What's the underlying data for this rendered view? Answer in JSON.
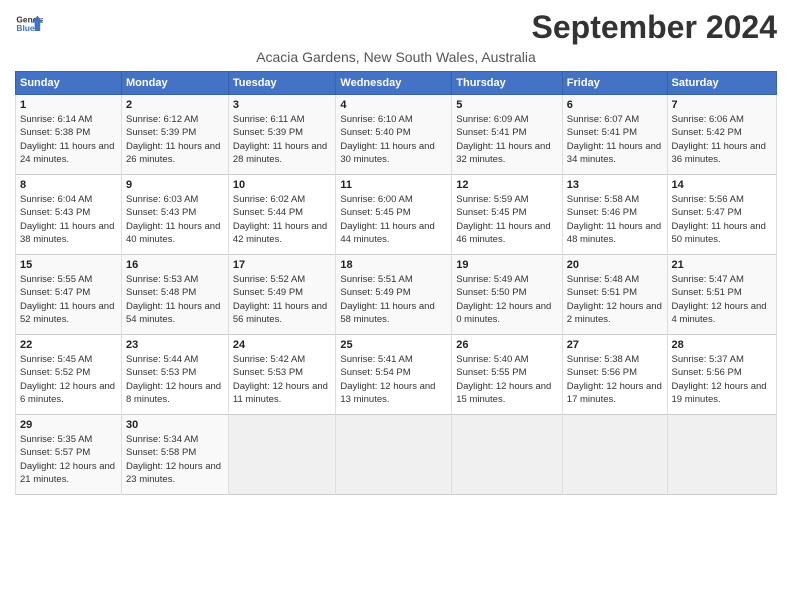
{
  "header": {
    "logo_line1": "General",
    "logo_line2": "Blue",
    "month": "September 2024",
    "location": "Acacia Gardens, New South Wales, Australia"
  },
  "weekdays": [
    "Sunday",
    "Monday",
    "Tuesday",
    "Wednesday",
    "Thursday",
    "Friday",
    "Saturday"
  ],
  "weeks": [
    [
      {
        "day": "1",
        "sunrise": "6:14 AM",
        "sunset": "5:38 PM",
        "daylight": "11 hours and 24 minutes."
      },
      {
        "day": "2",
        "sunrise": "6:12 AM",
        "sunset": "5:39 PM",
        "daylight": "11 hours and 26 minutes."
      },
      {
        "day": "3",
        "sunrise": "6:11 AM",
        "sunset": "5:39 PM",
        "daylight": "11 hours and 28 minutes."
      },
      {
        "day": "4",
        "sunrise": "6:10 AM",
        "sunset": "5:40 PM",
        "daylight": "11 hours and 30 minutes."
      },
      {
        "day": "5",
        "sunrise": "6:09 AM",
        "sunset": "5:41 PM",
        "daylight": "11 hours and 32 minutes."
      },
      {
        "day": "6",
        "sunrise": "6:07 AM",
        "sunset": "5:41 PM",
        "daylight": "11 hours and 34 minutes."
      },
      {
        "day": "7",
        "sunrise": "6:06 AM",
        "sunset": "5:42 PM",
        "daylight": "11 hours and 36 minutes."
      }
    ],
    [
      {
        "day": "8",
        "sunrise": "6:04 AM",
        "sunset": "5:43 PM",
        "daylight": "11 hours and 38 minutes."
      },
      {
        "day": "9",
        "sunrise": "6:03 AM",
        "sunset": "5:43 PM",
        "daylight": "11 hours and 40 minutes."
      },
      {
        "day": "10",
        "sunrise": "6:02 AM",
        "sunset": "5:44 PM",
        "daylight": "11 hours and 42 minutes."
      },
      {
        "day": "11",
        "sunrise": "6:00 AM",
        "sunset": "5:45 PM",
        "daylight": "11 hours and 44 minutes."
      },
      {
        "day": "12",
        "sunrise": "5:59 AM",
        "sunset": "5:45 PM",
        "daylight": "11 hours and 46 minutes."
      },
      {
        "day": "13",
        "sunrise": "5:58 AM",
        "sunset": "5:46 PM",
        "daylight": "11 hours and 48 minutes."
      },
      {
        "day": "14",
        "sunrise": "5:56 AM",
        "sunset": "5:47 PM",
        "daylight": "11 hours and 50 minutes."
      }
    ],
    [
      {
        "day": "15",
        "sunrise": "5:55 AM",
        "sunset": "5:47 PM",
        "daylight": "11 hours and 52 minutes."
      },
      {
        "day": "16",
        "sunrise": "5:53 AM",
        "sunset": "5:48 PM",
        "daylight": "11 hours and 54 minutes."
      },
      {
        "day": "17",
        "sunrise": "5:52 AM",
        "sunset": "5:49 PM",
        "daylight": "11 hours and 56 minutes."
      },
      {
        "day": "18",
        "sunrise": "5:51 AM",
        "sunset": "5:49 PM",
        "daylight": "11 hours and 58 minutes."
      },
      {
        "day": "19",
        "sunrise": "5:49 AM",
        "sunset": "5:50 PM",
        "daylight": "12 hours and 0 minutes."
      },
      {
        "day": "20",
        "sunrise": "5:48 AM",
        "sunset": "5:51 PM",
        "daylight": "12 hours and 2 minutes."
      },
      {
        "day": "21",
        "sunrise": "5:47 AM",
        "sunset": "5:51 PM",
        "daylight": "12 hours and 4 minutes."
      }
    ],
    [
      {
        "day": "22",
        "sunrise": "5:45 AM",
        "sunset": "5:52 PM",
        "daylight": "12 hours and 6 minutes."
      },
      {
        "day": "23",
        "sunrise": "5:44 AM",
        "sunset": "5:53 PM",
        "daylight": "12 hours and 8 minutes."
      },
      {
        "day": "24",
        "sunrise": "5:42 AM",
        "sunset": "5:53 PM",
        "daylight": "12 hours and 11 minutes."
      },
      {
        "day": "25",
        "sunrise": "5:41 AM",
        "sunset": "5:54 PM",
        "daylight": "12 hours and 13 minutes."
      },
      {
        "day": "26",
        "sunrise": "5:40 AM",
        "sunset": "5:55 PM",
        "daylight": "12 hours and 15 minutes."
      },
      {
        "day": "27",
        "sunrise": "5:38 AM",
        "sunset": "5:56 PM",
        "daylight": "12 hours and 17 minutes."
      },
      {
        "day": "28",
        "sunrise": "5:37 AM",
        "sunset": "5:56 PM",
        "daylight": "12 hours and 19 minutes."
      }
    ],
    [
      {
        "day": "29",
        "sunrise": "5:35 AM",
        "sunset": "5:57 PM",
        "daylight": "12 hours and 21 minutes."
      },
      {
        "day": "30",
        "sunrise": "5:34 AM",
        "sunset": "5:58 PM",
        "daylight": "12 hours and 23 minutes."
      },
      null,
      null,
      null,
      null,
      null
    ]
  ]
}
